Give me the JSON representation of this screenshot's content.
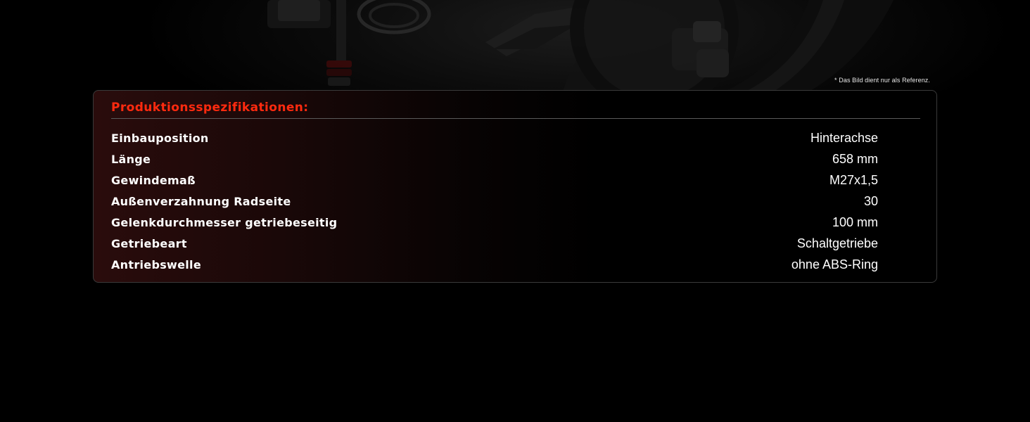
{
  "hero": {
    "image_icon": "drive-shaft-product-photo",
    "disclaimer": "* Das Bild dient nur als Referenz."
  },
  "specs": {
    "title": "Produktionsspezifikationen:",
    "accent_color": "#ff2a0f",
    "rows": [
      {
        "label": "Einbauposition",
        "value": "Hinterachse"
      },
      {
        "label": "Länge",
        "value": "658 mm"
      },
      {
        "label": "Gewindemaß",
        "value": "M27x1,5"
      },
      {
        "label": "Außenverzahnung Radseite",
        "value": "30"
      },
      {
        "label": "Gelenkdurchmesser getriebeseitig",
        "value": "100 mm"
      },
      {
        "label": "Getriebeart",
        "value": "Schaltgetriebe"
      },
      {
        "label": "Antriebswelle",
        "value": "ohne ABS-Ring"
      }
    ]
  }
}
